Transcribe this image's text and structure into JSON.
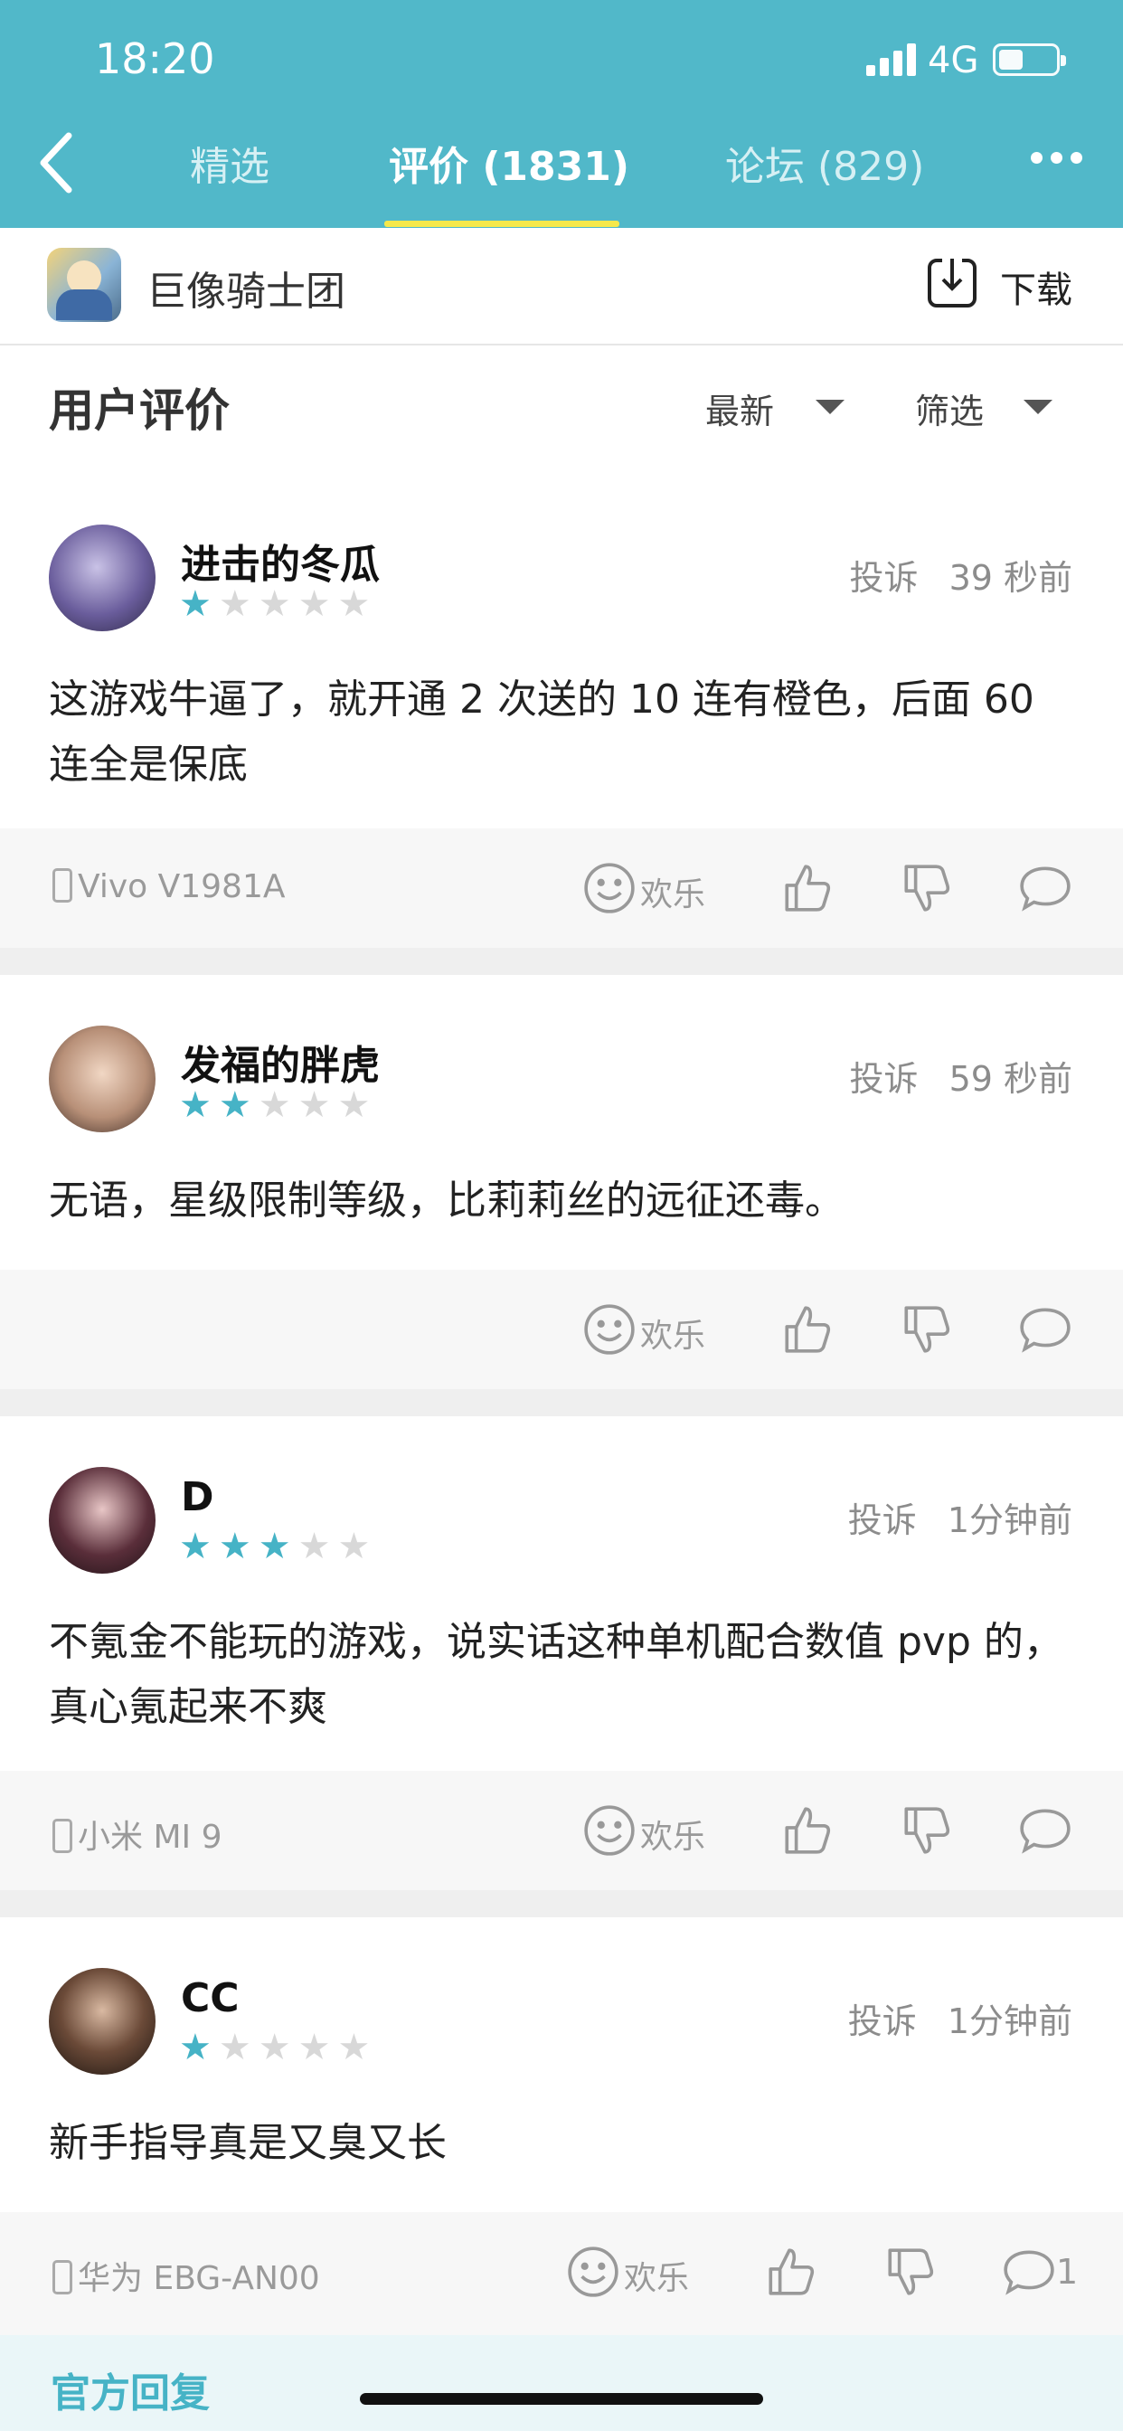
{
  "status_bar": {
    "time": "18:20",
    "network": "4G"
  },
  "nav": {
    "tabs": [
      {
        "label": "精选",
        "active": false
      },
      {
        "label": "评价 (1831)",
        "active": true
      },
      {
        "label": "论坛 (829)",
        "active": false
      }
    ]
  },
  "app": {
    "name": "巨像骑士团",
    "download_label": "下载"
  },
  "reviews_section": {
    "title": "用户评价",
    "sort_label": "最新",
    "filter_label": "筛选"
  },
  "reviews": [
    {
      "username": "进击的冬瓜",
      "rating": 1,
      "complaint": "投诉",
      "time": "39 秒前",
      "text": "这游戏牛逼了，就开通 2 次送的 10 连有橙色，后面 60 连全是保底",
      "device": "Vivo V1981A",
      "happy_label": "欢乐",
      "reply_count": ""
    },
    {
      "username": "发福的胖虎",
      "rating": 2,
      "complaint": "投诉",
      "time": "59 秒前",
      "text": "无语，星级限制等级，比莉莉丝的远征还毒。",
      "device": "",
      "happy_label": "欢乐",
      "reply_count": ""
    },
    {
      "username": "D",
      "rating": 3,
      "complaint": "投诉",
      "time": "1分钟前",
      "text": "不氪金不能玩的游戏，说实话这种单机配合数值 pvp 的，真心氪起来不爽",
      "device": "小米 MI 9",
      "happy_label": "欢乐",
      "reply_count": ""
    },
    {
      "username": "CC",
      "rating": 1,
      "complaint": "投诉",
      "time": "1分钟前",
      "text": "新手指导真是又臭又长",
      "device": "华为 EBG-AN00",
      "happy_label": "欢乐",
      "reply_count": "1"
    }
  ],
  "official_reply": {
    "label": "官方回复"
  },
  "colors": {
    "header": "#51b8c9",
    "accent": "#46b3c6",
    "tab_underline": "#f5e84b"
  }
}
